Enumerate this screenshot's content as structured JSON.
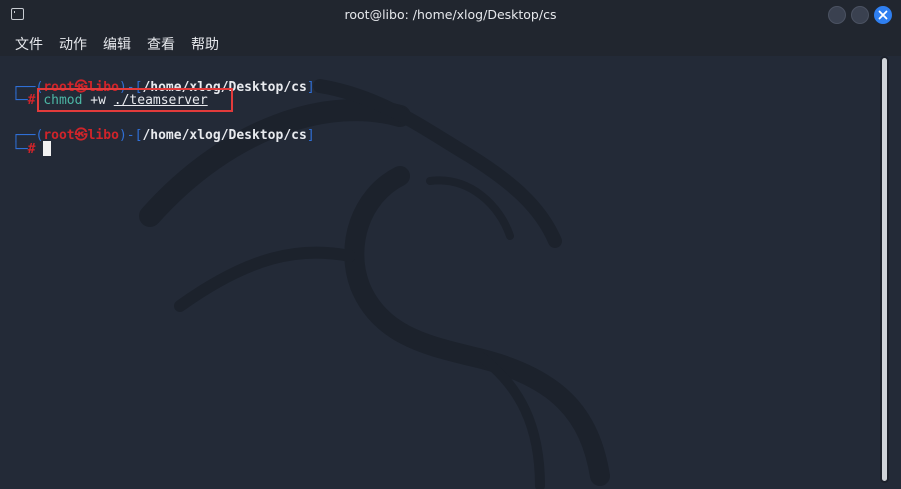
{
  "window": {
    "title": "root@libo: /home/xlog/Desktop/cs",
    "icon": "terminal-icon",
    "accent_color": "#2f7ff0"
  },
  "menu": [
    "文件",
    "动作",
    "编辑",
    "查看",
    "帮助"
  ],
  "prompt": {
    "open": "┌──(",
    "user": "root",
    "at": "㉿",
    "host": "libo",
    "mid": ")-[",
    "path": "/home/xlog/Desktop/cs",
    "close": "]",
    "second_line": "└─",
    "symbol": "#"
  },
  "history": {
    "command": "chmod",
    "flag": "+w",
    "target": "./teamserver"
  },
  "colors": {
    "prompt_frame": "#2f6fd6",
    "prompt_user": "#d0242a",
    "command": "#4cb7a5",
    "highlight_box": "#e23b3b"
  }
}
